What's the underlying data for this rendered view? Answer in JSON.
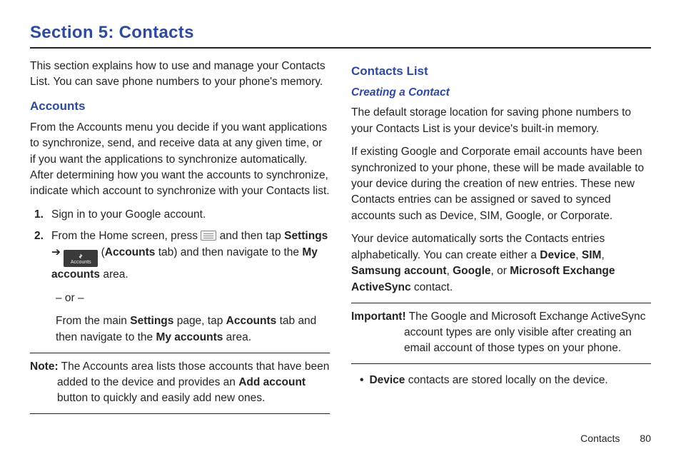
{
  "section_title": "Section 5: Contacts",
  "left": {
    "intro": "This section explains how to use and manage your Contacts List. You can save phone numbers to your phone's memory.",
    "accounts_heading": "Accounts",
    "accounts_desc": "From the Accounts menu you decide if you want applications to synchronize, send, and receive data at any given time, or if you want the applications to synchronize automatically. After determining how you want the accounts to synchronize, indicate which account to synchronize with your Contacts list.",
    "step1": "Sign in to your Google account.",
    "step2_a": "From the Home screen, press ",
    "step2_b": " and then tap ",
    "step2_settings": "Settings",
    "step2_arrow": " ➔ ",
    "step2_c": " (",
    "step2_accounts_tab": "Accounts",
    "step2_d": " tab) and then navigate to the ",
    "step2_myaccounts": "My accounts",
    "step2_e": " area.",
    "or": "– or –",
    "step2_alt_a": "From the main ",
    "step2_alt_settings": "Settings",
    "step2_alt_b": " page, tap ",
    "step2_alt_accounts": "Accounts",
    "step2_alt_c": " tab and then navigate to the ",
    "step2_alt_my": "My accounts",
    "step2_alt_d": " area.",
    "note_label": "Note:",
    "note_a": " The Accounts area lists those accounts that have been added to the device and provides an ",
    "note_add": "Add account",
    "note_b": " button to quickly and easily add new ones.",
    "icon_accounts_label": "Accounts"
  },
  "right": {
    "contacts_list_heading": "Contacts List",
    "creating_heading": "Creating a Contact",
    "p1": "The default storage location for saving phone numbers to your Contacts List is your device's built-in memory.",
    "p2": "If existing Google and Corporate email accounts have been synchronized to your phone, these will be made available to your device during the creation of new entries. These new Contacts entries can be assigned or saved to synced accounts such as Device, SIM, Google, or Corporate.",
    "p3_a": "Your device automatically sorts the Contacts entries alphabetically. You can create either a ",
    "p3_device": "Device",
    "p3_b": ", ",
    "p3_sim": "SIM",
    "p3_c": ", ",
    "p3_samsung": "Samsung account",
    "p3_d": ", ",
    "p3_google": "Google",
    "p3_e": ", or ",
    "p3_ms": "Microsoft Exchange ActiveSync",
    "p3_f": " contact.",
    "important_label": "Important!",
    "important_body": " The Google and Microsoft Exchange ActiveSync account types are only visible after creating an email account of those types on your phone.",
    "bullet_a": "",
    "bullet_device": "Device",
    "bullet_b": " contacts are stored locally on the device."
  },
  "footer": {
    "label": "Contacts",
    "page": "80"
  }
}
